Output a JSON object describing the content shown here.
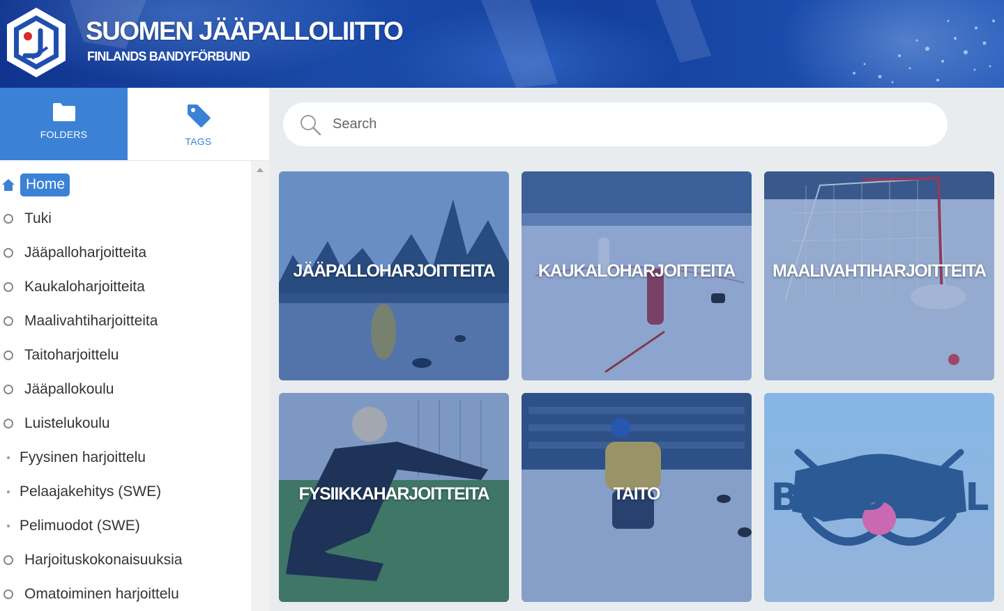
{
  "header": {
    "title": "SUOMEN JÄÄPALLOLIITTO",
    "subtitle": "FINLANDS BANDYFÖRBUND",
    "logo_icon": "bandy-federation-logo"
  },
  "sidebar": {
    "tabs": [
      {
        "label": "FOLDERS",
        "icon": "folder-icon",
        "active": true
      },
      {
        "label": "TAGS",
        "icon": "tag-icon",
        "active": false
      }
    ],
    "home_label": "Home",
    "items": [
      {
        "label": "Tuki"
      },
      {
        "label": "Jääpalloharjoitteita"
      },
      {
        "label": "Kaukaloharjoitteita"
      },
      {
        "label": "Maalivahtiharjoitteita"
      },
      {
        "label": "Taitoharjoittelu"
      },
      {
        "label": "Jääpallokoulu"
      },
      {
        "label": "Luistelukoulu"
      },
      {
        "label": "Fyysinen harjoittelu"
      },
      {
        "label": "Pelaajakehitys (SWE)"
      },
      {
        "label": "Pelimuodot (SWE)"
      },
      {
        "label": "Harjoituskokonaisuuksia"
      },
      {
        "label": "Omatoiminen harjoittelu"
      }
    ]
  },
  "search": {
    "placeholder": "Search"
  },
  "tiles": [
    {
      "label": "JÄÄPALLOHARJOITTEITA"
    },
    {
      "label": "KAUKALOHARJOITTEITA"
    },
    {
      "label": "MAALIVAHTIHARJOITTEITA"
    },
    {
      "label": "FYSIIKKAHARJOITTEITA"
    },
    {
      "label": "TAITO"
    },
    {
      "label": "BANDYKUL"
    }
  ],
  "colors": {
    "accent": "#3b82d6",
    "header_bg": "#1a4aa8",
    "content_bg": "#e9ecef"
  }
}
